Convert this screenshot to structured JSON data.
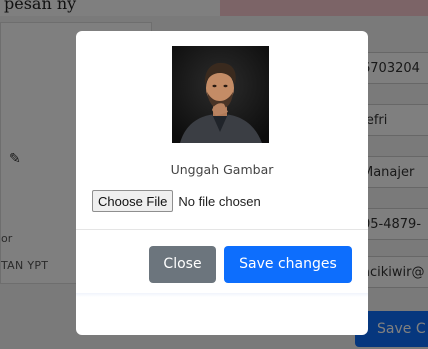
{
  "background": {
    "top_text": "pesan ny",
    "side_text_1": "or",
    "side_text_2": "TAN YPT",
    "fields": [
      {
        "value": "6703204"
      },
      {
        "value": "Jefri"
      },
      {
        "value": "Manajer"
      },
      {
        "value": "05-4879-"
      },
      {
        "value": "acikiwir@"
      }
    ],
    "save_label": "Save C"
  },
  "modal": {
    "upload_label": "Unggah Gambar",
    "file_button": "Choose File",
    "file_status": "No file chosen",
    "close_label": "Close",
    "save_label": "Save changes"
  },
  "colors": {
    "primary": "#0d6efd",
    "secondary": "#6c757d",
    "backdrop": "rgba(0,0,0,0.5)"
  }
}
